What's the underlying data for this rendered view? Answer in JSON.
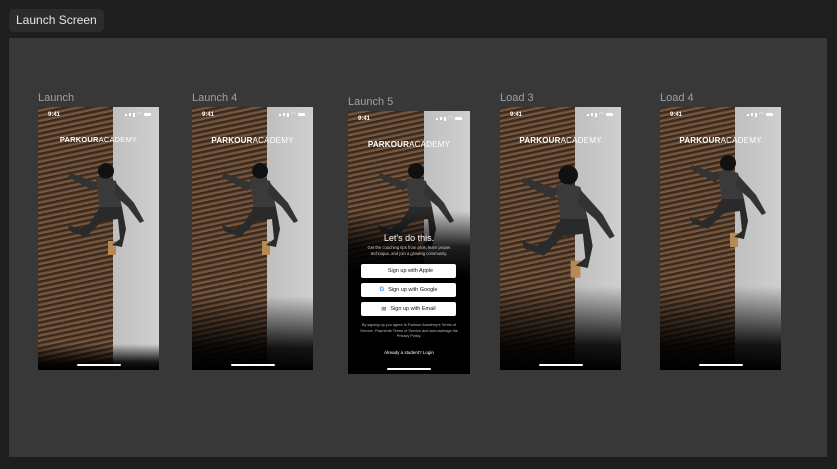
{
  "page_tab": "Launch Screen",
  "frames": [
    {
      "label": "Launch",
      "time": "9:41",
      "logo_bold": "PARKOUR",
      "logo_light": "ACADEMY"
    },
    {
      "label": "Launch 4",
      "time": "9:41",
      "logo_bold": "PARKOUR",
      "logo_light": "ACADEMY"
    },
    {
      "label": "Launch 5",
      "time": "9:41",
      "logo_bold": "PARKOUR",
      "logo_light": "ACADEMY",
      "headline": "Let's do this.",
      "subtext": "Get the coaching tips from pros, learn proper technique, and join a growing community.",
      "buttons": {
        "apple": "Sign up with Apple",
        "google": "Sign up with Google",
        "email": "Sign up with Email"
      },
      "terms": "By signing up you agree to Parkour Academy's Terms of Service, Payments Terms of Service and acknowledge the Privacy Policy.",
      "login": "Already a student? Login"
    },
    {
      "label": "Load 3",
      "time": "9:41",
      "logo_bold": "PARKOUR",
      "logo_light": "ACADEMY"
    },
    {
      "label": "Load 4",
      "time": "9:41",
      "logo_bold": "PARKOUR",
      "logo_light": "ACADEMY"
    }
  ]
}
